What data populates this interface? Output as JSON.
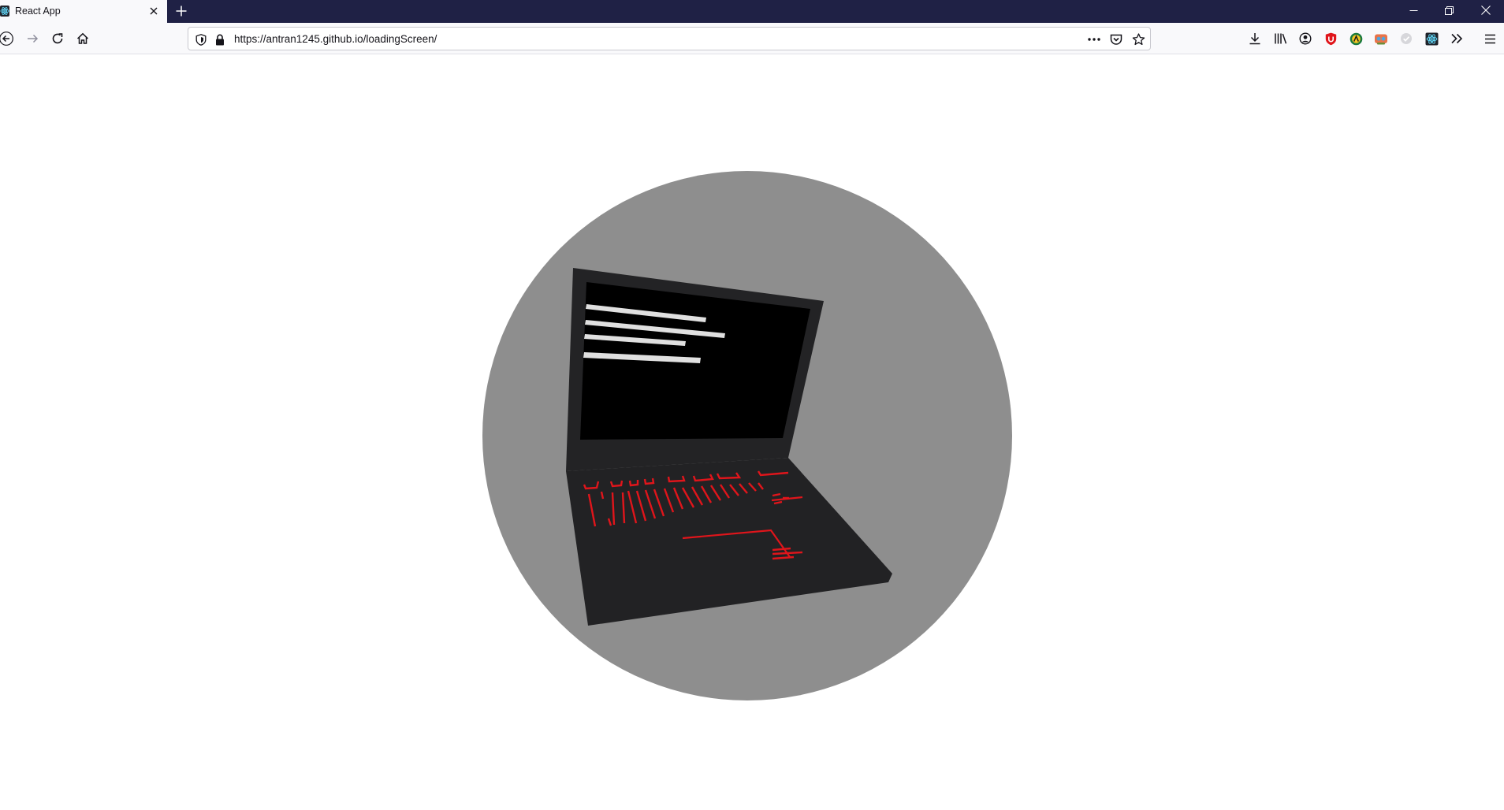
{
  "browser": {
    "tab": {
      "title": "React App",
      "favicon": "react-icon"
    },
    "new_tab_icon": "plus-icon",
    "window_controls": [
      "minimize-icon",
      "restore-icon",
      "close-icon"
    ],
    "nav": {
      "back": "back-arrow-icon",
      "forward": "forward-arrow-icon",
      "reload": "reload-icon",
      "home": "home-icon"
    },
    "urlbar": {
      "url": "https://antran1245.github.io/loadingScreen/"
    },
    "toolbar_icons": [
      "download-icon",
      "library-icon",
      "account-icon",
      "ublock-icon",
      "extension-icon",
      "extension-icon",
      "extension-icon",
      "react-devtools-icon",
      "overflow-icon",
      "menu-icon"
    ]
  },
  "page": {
    "background": "#ffffff",
    "circle_color": "#8e8e8e",
    "laptop": {
      "body_color": "#222224",
      "screen_color": "#000000",
      "code_line_color": "#e0e0e0",
      "key_color": "#e0151b"
    }
  }
}
